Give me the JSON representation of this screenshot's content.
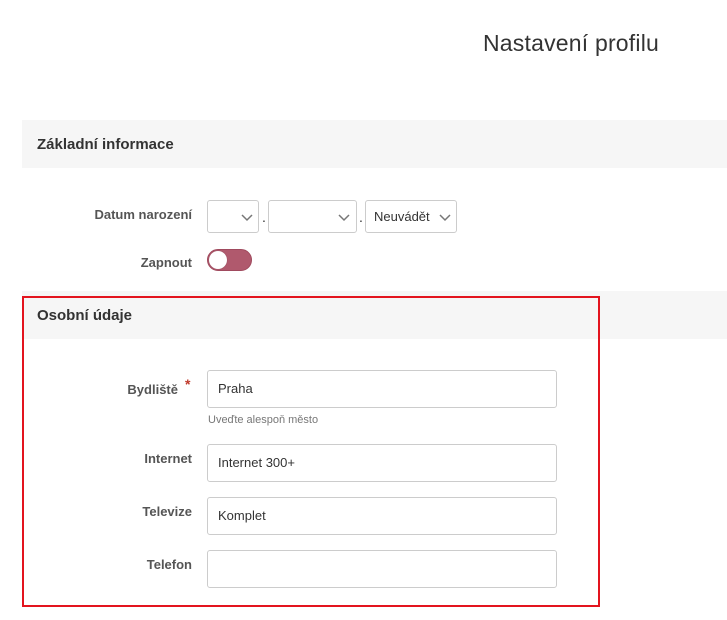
{
  "page": {
    "title": "Nastavení profilu"
  },
  "sections": {
    "basic": {
      "title": "Základní informace"
    },
    "personal": {
      "title": "Osobní údaje"
    }
  },
  "birthdate": {
    "label": "Datum narození",
    "day": "",
    "month": "",
    "year": "Neuvádět",
    "separator": "."
  },
  "toggle": {
    "label": "Zapnout",
    "state": "off"
  },
  "fields": {
    "residence": {
      "label": "Bydliště",
      "required_mark": "*",
      "value": "Praha",
      "help": "Uveďte alespoň město"
    },
    "internet": {
      "label": "Internet",
      "value": "Internet 300+"
    },
    "television": {
      "label": "Televize",
      "value": "Komplet"
    },
    "phone": {
      "label": "Telefon",
      "value": ""
    }
  },
  "colors": {
    "toggle_track": "#b0596d",
    "highlight_border": "#e3141e",
    "required": "#c0392b"
  }
}
